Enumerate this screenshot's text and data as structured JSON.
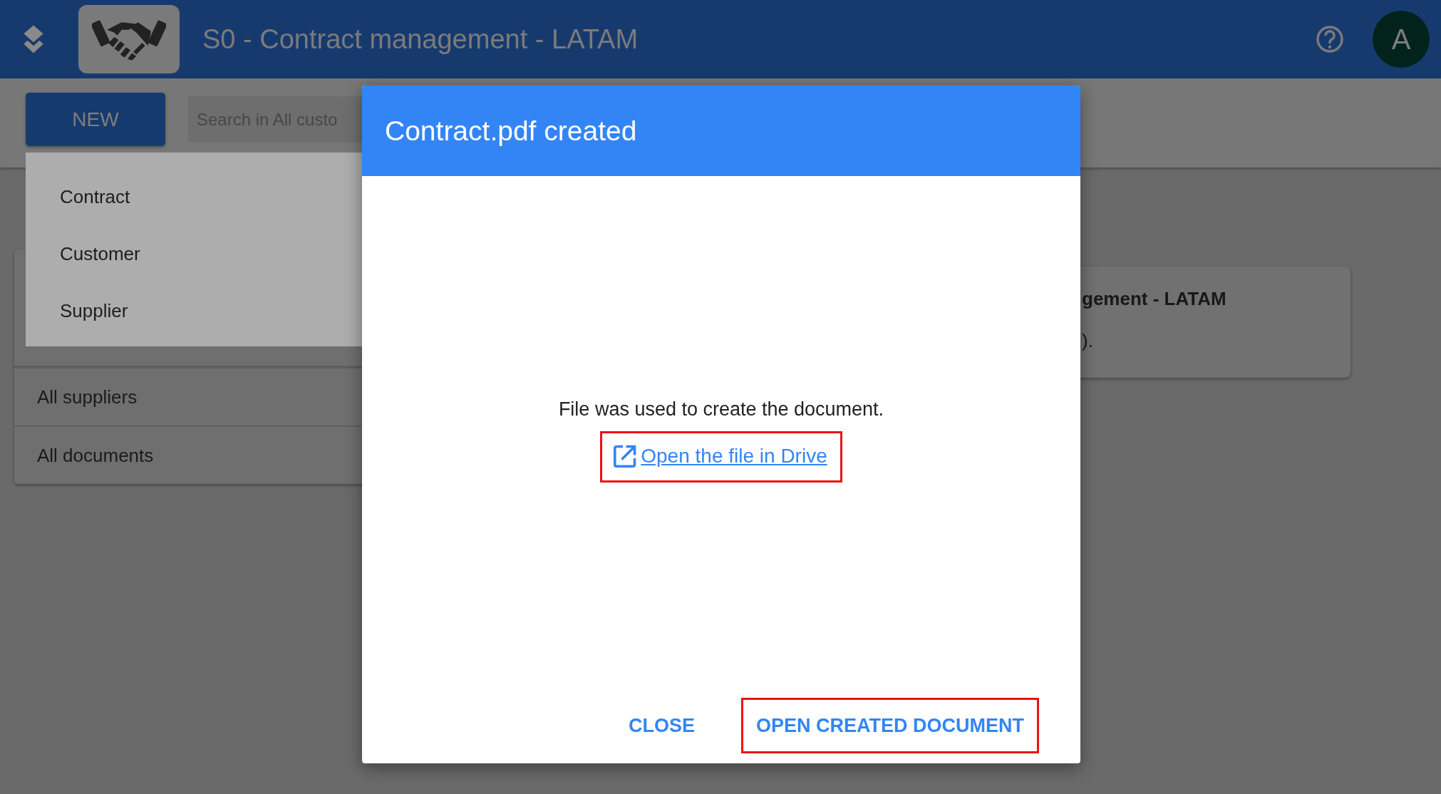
{
  "header": {
    "title": "S0 - Contract management - LATAM",
    "avatar": "A"
  },
  "toolbar": {
    "new_button": "NEW",
    "search": {
      "placeholder": "Search in All custo"
    }
  },
  "new_menu": {
    "items": [
      {
        "label": "Contract"
      },
      {
        "label": "Customer"
      },
      {
        "label": "Supplier"
      }
    ]
  },
  "sidebar": {
    "items": [
      {
        "label": "All suppliers"
      },
      {
        "label": "All documents"
      }
    ]
  },
  "info_card": {
    "title": "gement - LATAM",
    "text": ")."
  },
  "dialog": {
    "title": "Contract.pdf created",
    "message": "File was used to create the document.",
    "link": {
      "label": "Open the file in Drive",
      "highlighted": true
    },
    "buttons": [
      {
        "label": "CLOSE",
        "highlighted": false
      },
      {
        "label": "OPEN CREATED DOCUMENT",
        "highlighted": true
      }
    ]
  }
}
